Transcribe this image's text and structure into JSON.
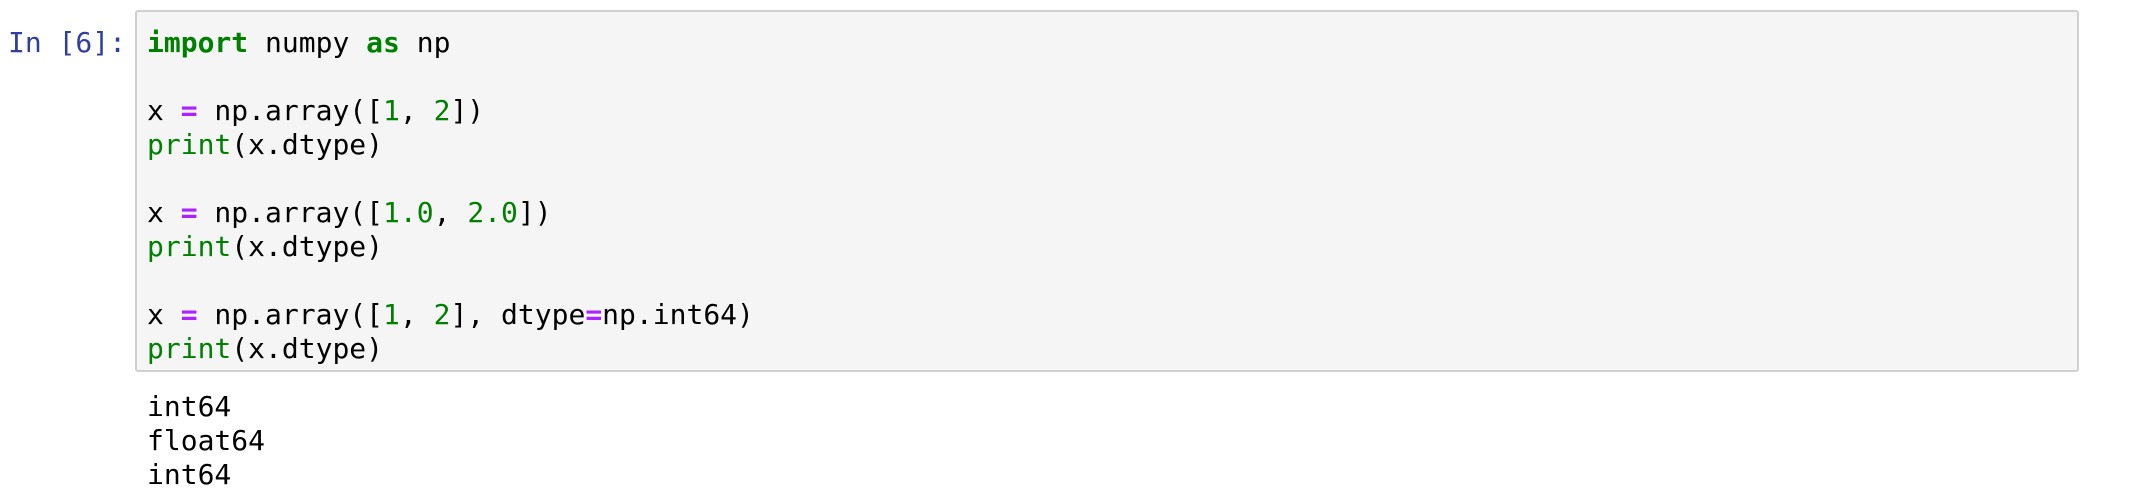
{
  "cell": {
    "prompt": "In [6]:",
    "code": {
      "l1_kw_import": "import",
      "l1_mod": " numpy ",
      "l1_kw_as": "as",
      "l1_alias": " np",
      "l3_var": "x ",
      "l3_eq": "=",
      "l3_call": " np.array([",
      "l3_n1": "1",
      "l3_sep": ", ",
      "l3_n2": "2",
      "l3_end": "])",
      "l4_print": "print",
      "l4_arg": "(x.dtype)",
      "l6_var": "x ",
      "l6_eq": "=",
      "l6_call": " np.array([",
      "l6_n1": "1.0",
      "l6_sep": ", ",
      "l6_n2": "2.0",
      "l6_end": "])",
      "l7_print": "print",
      "l7_arg": "(x.dtype)",
      "l9_var": "x ",
      "l9_eq": "=",
      "l9_call": " np.array([",
      "l9_n1": "1",
      "l9_sep": ", ",
      "l9_n2": "2",
      "l9_mid": "], dtype",
      "l9_eq2": "=",
      "l9_end": "np.int64)",
      "l10_print": "print",
      "l10_arg": "(x.dtype)"
    },
    "output": [
      "int64",
      "float64",
      "int64"
    ]
  }
}
